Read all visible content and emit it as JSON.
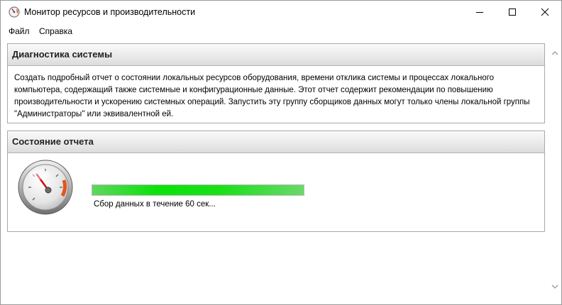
{
  "window": {
    "title": "Монитор ресурсов и производительности"
  },
  "menu": {
    "items": [
      "Файл",
      "Справка"
    ]
  },
  "diagnostics": {
    "title": "Диагностика системы",
    "description": "Создать подробный отчет о состоянии локальных ресурсов оборудования, времени отклика системы и процессах локального компьютера, содержащий также системные и конфигурационные данные. Этот отчет содержит рекомендации по повышению производительности и ускорению системных операций. Запустить эту группу сборщиков данных могут только члены локальной группы \"Администраторы\" или эквивалентной ей."
  },
  "report_status": {
    "title": "Состояние отчета",
    "progress_fraction": 1.0,
    "status_text": "Сбор данных в течение 60 сек..."
  },
  "icons": {
    "app": "performance-monitor-gauge-icon",
    "gauge": "speedometer-gauge-icon",
    "minimize": "minimize-icon",
    "maximize": "maximize-icon",
    "close": "close-icon",
    "scroll_up": "chevron-up-icon",
    "scroll_down": "chevron-down-icon"
  },
  "colors": {
    "progress": "#0ae20a",
    "panel_border": "#a9a9a9",
    "gauge_needle": "#d01010"
  }
}
